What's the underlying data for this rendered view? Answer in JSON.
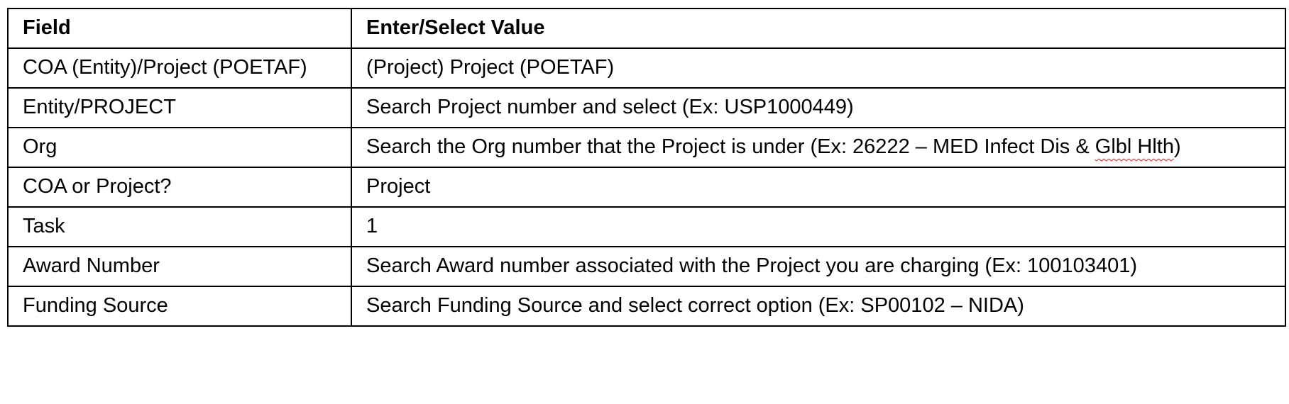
{
  "table": {
    "headers": {
      "field": "Field",
      "value": "Enter/Select Value"
    },
    "rows": [
      {
        "field": "COA (Entity)/Project (POETAF)",
        "value": "(Project) Project (POETAF)"
      },
      {
        "field": "Entity/PROJECT",
        "value": "Search Project number and select (Ex: USP1000449)"
      },
      {
        "field": "Org",
        "value_pre": "Search the Org number that the Project is under (Ex: 26222 – MED Infect Dis & ",
        "value_spell": "Glbl Hlth",
        "value_post": ")"
      },
      {
        "field": "COA or Project?",
        "value": "Project"
      },
      {
        "field": "Task",
        "value": "1"
      },
      {
        "field": "Award Number",
        "value": "Search Award number associated with the Project you are charging (Ex: 100103401)"
      },
      {
        "field": "Funding Source",
        "value": "Search Funding Source and select correct option (Ex: SP00102 – NIDA)"
      }
    ]
  }
}
